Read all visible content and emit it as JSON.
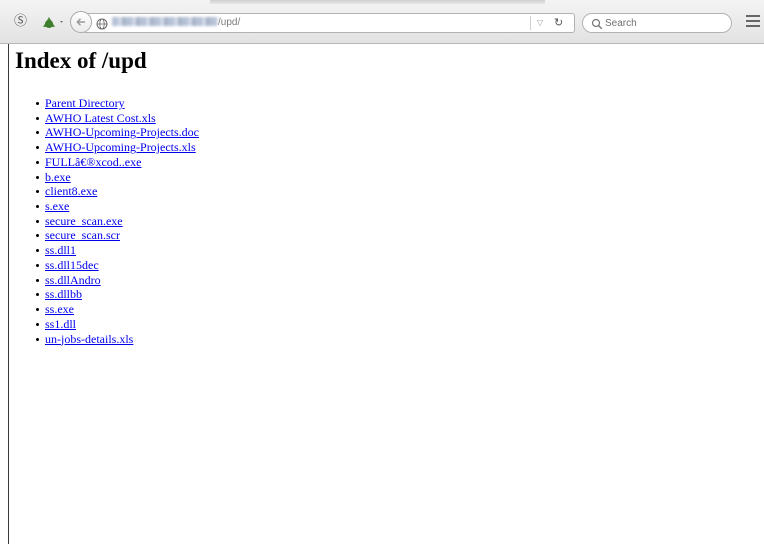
{
  "browser": {
    "url_visible_path": "/upd/",
    "search_placeholder": "Search",
    "icons": {
      "sync": "s-icon",
      "extension": "extension-icon",
      "back": "back-arrow-icon",
      "site_identity": "globe-icon",
      "dropdown": "dropdown-arrow-icon",
      "reload": "reload-icon",
      "search": "search-icon",
      "menu": "hamburger-menu-icon"
    }
  },
  "page": {
    "title": "Index of /upd",
    "links": [
      {
        "label": "Parent Directory"
      },
      {
        "label": "AWHO Latest Cost.xls"
      },
      {
        "label": "AWHO-Upcoming-Projects.doc"
      },
      {
        "label": "AWHO-Upcoming-Projects.xls"
      },
      {
        "label": "FULLâ€®xcod..exe"
      },
      {
        "label": "b.exe"
      },
      {
        "label": "client8.exe"
      },
      {
        "label": "s.exe"
      },
      {
        "label": "secure_scan.exe"
      },
      {
        "label": "secure_scan.scr"
      },
      {
        "label": "ss.dll1"
      },
      {
        "label": "ss.dll15dec"
      },
      {
        "label": "ss.dllAndro"
      },
      {
        "label": "ss.dllbb"
      },
      {
        "label": "ss.exe"
      },
      {
        "label": "ss1.dll"
      },
      {
        "label": "un-jobs-details.xls"
      }
    ]
  },
  "colors": {
    "link": "#0000ee",
    "toolbar_bg": "#e9e9e9",
    "page_bg": "#ffffff"
  }
}
